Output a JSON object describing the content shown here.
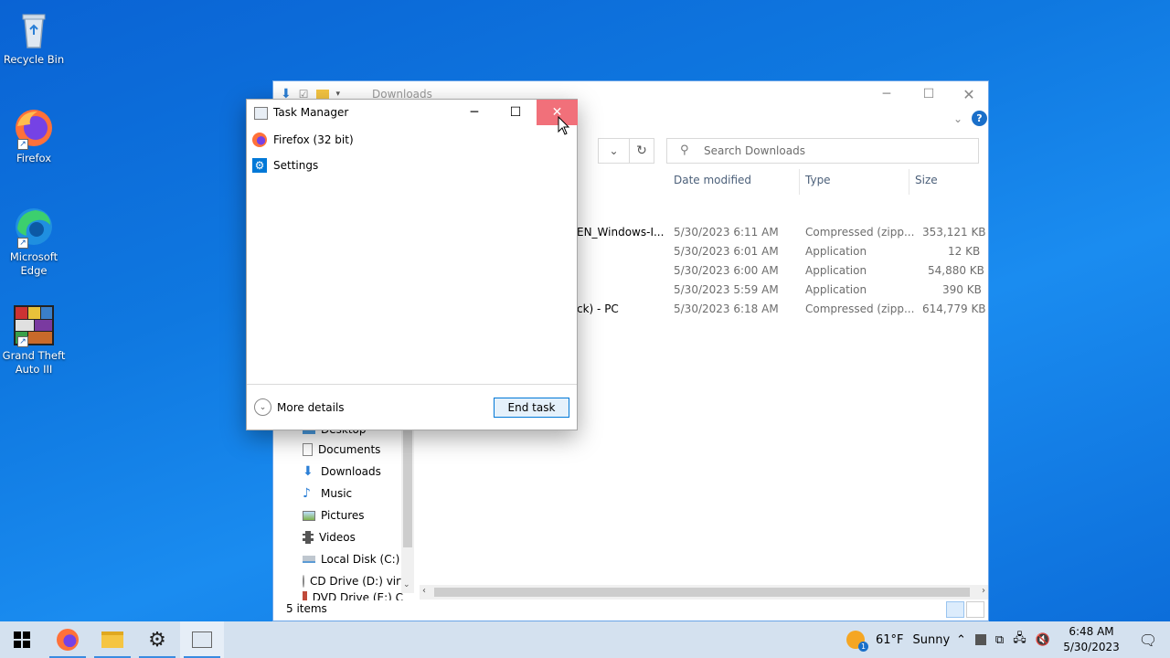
{
  "desktop": {
    "icons": [
      {
        "label": "Recycle Bin"
      },
      {
        "label": "Firefox"
      },
      {
        "label": "Microsoft Edge"
      },
      {
        "label": "Grand Theft Auto III"
      }
    ]
  },
  "explorer": {
    "title": "Downloads",
    "search_placeholder": "Search Downloads",
    "columns": {
      "date": "Date modified",
      "type": "Type",
      "size": "Size"
    },
    "files": [
      {
        "name": "EN_Windows-I...",
        "date": "5/30/2023 6:11 AM",
        "type": "Compressed (zipp...",
        "size": "353,121 KB"
      },
      {
        "name": "",
        "date": "5/30/2023 6:01 AM",
        "type": "Application",
        "size": "12 KB"
      },
      {
        "name": "",
        "date": "5/30/2023 6:00 AM",
        "type": "Application",
        "size": "54,880 KB"
      },
      {
        "name": "",
        "date": "5/30/2023 5:59 AM",
        "type": "Application",
        "size": "390 KB"
      },
      {
        "name": "ck) - PC",
        "date": "5/30/2023 6:18 AM",
        "type": "Compressed (zipp...",
        "size": "614,779 KB"
      }
    ],
    "nav": [
      {
        "label": "Desktop"
      },
      {
        "label": "Documents"
      },
      {
        "label": "Downloads"
      },
      {
        "label": "Music"
      },
      {
        "label": "Pictures"
      },
      {
        "label": "Videos"
      },
      {
        "label": "Local Disk (C:)"
      },
      {
        "label": "CD Drive (D:) virt"
      },
      {
        "label": "DVD Drive (E:) C"
      }
    ],
    "status": "5 items"
  },
  "taskmgr": {
    "title": "Task Manager",
    "apps": [
      {
        "label": "Firefox (32 bit)"
      },
      {
        "label": "Settings"
      }
    ],
    "more_details": "More details",
    "end_task": "End task"
  },
  "taskbar": {
    "weather_temp": "61°F",
    "weather_text": "Sunny",
    "time": "6:48 AM",
    "date": "5/30/2023",
    "notif_count": "1"
  }
}
